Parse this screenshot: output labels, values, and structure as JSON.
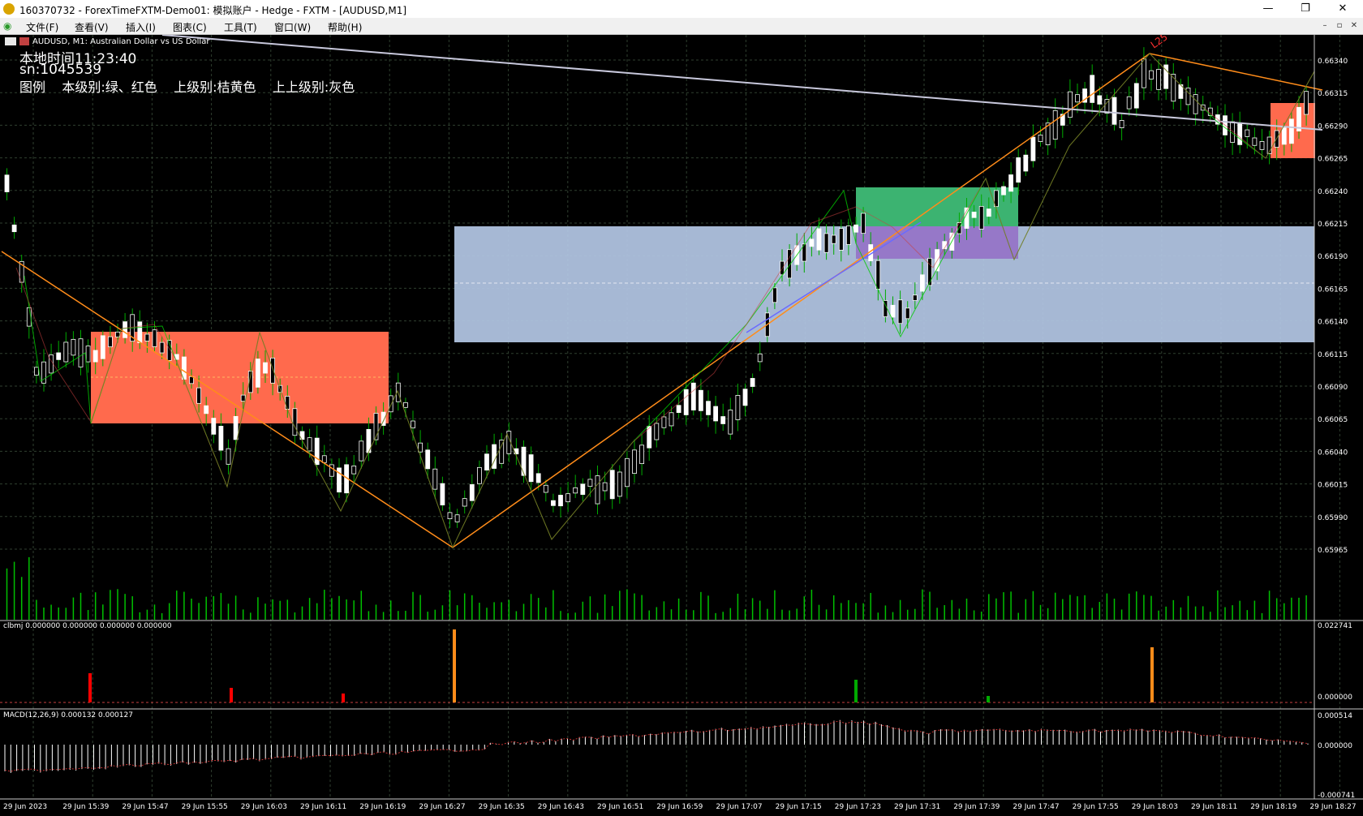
{
  "window": {
    "title": "160370732 - ForexTimeFXTM-Demo01: 模拟账户 - Hedge - FXTM - [AUDUSD,M1]",
    "controls": [
      "—",
      "❐",
      "✕"
    ]
  },
  "menu": {
    "items": [
      "文件(F)",
      "查看(V)",
      "插入(I)",
      "图表(C)",
      "工具(T)",
      "窗口(W)",
      "帮助(H)"
    ],
    "child_controls": [
      "–",
      "▫",
      "✕"
    ]
  },
  "chart": {
    "symbol_line": "AUDUSD, M1:  Australian Dollar vs US Dollar",
    "local_time": "本地时间11:23:40",
    "sn": "sn:1045539",
    "legend": "图例    本级别:绿、红色    上级别:桔黄色    上上级别:灰色",
    "marker_label": "L25",
    "colors": {
      "bull_candle": "#ffffff",
      "bear_candle": "#ffffff",
      "wick": "#00aa00",
      "orange_trend": "#ff8c1a",
      "gray_trend": "#c8c8dc",
      "blue_trend": "#6a6aff",
      "zone_red": "#ff6a4d",
      "zone_blue": "#b4c8e6",
      "zone_green": "#3cb371",
      "zone_purple": "#9678c8",
      "grid": "#3a4a3a"
    },
    "price_ticks": [
      "0.66340",
      "0.66315",
      "0.66290",
      "0.66265",
      "0.66240",
      "0.66215",
      "0.66190",
      "0.66165",
      "0.66140",
      "0.66115",
      "0.66090",
      "0.66065",
      "0.66040",
      "0.66015",
      "0.65990",
      "0.65965"
    ],
    "time_ticks": [
      "29 Jun 2023",
      "29 Jun 15:39",
      "29 Jun 15:47",
      "29 Jun 15:55",
      "29 Jun 16:03",
      "29 Jun 16:11",
      "29 Jun 16:19",
      "29 Jun 16:27",
      "29 Jun 16:35",
      "29 Jun 16:43",
      "29 Jun 16:51",
      "29 Jun 16:59",
      "29 Jun 17:07",
      "29 Jun 17:15",
      "29 Jun 17:23",
      "29 Jun 17:31",
      "29 Jun 17:39",
      "29 Jun 17:47",
      "29 Jun 17:55",
      "29 Jun 18:03",
      "29 Jun 18:11",
      "29 Jun 18:19",
      "29 Jun 18:27"
    ]
  },
  "subwindow1": {
    "label": "clbmj 0.000000 0.000000 0.000000 0.000000",
    "ticks": [
      "0.022741",
      "0.000000"
    ]
  },
  "subwindow2": {
    "label": "MACD(12,26,9) 0.000132 0.000127",
    "ticks": [
      "0.000514",
      "0.000000",
      "-0.000741"
    ]
  }
}
